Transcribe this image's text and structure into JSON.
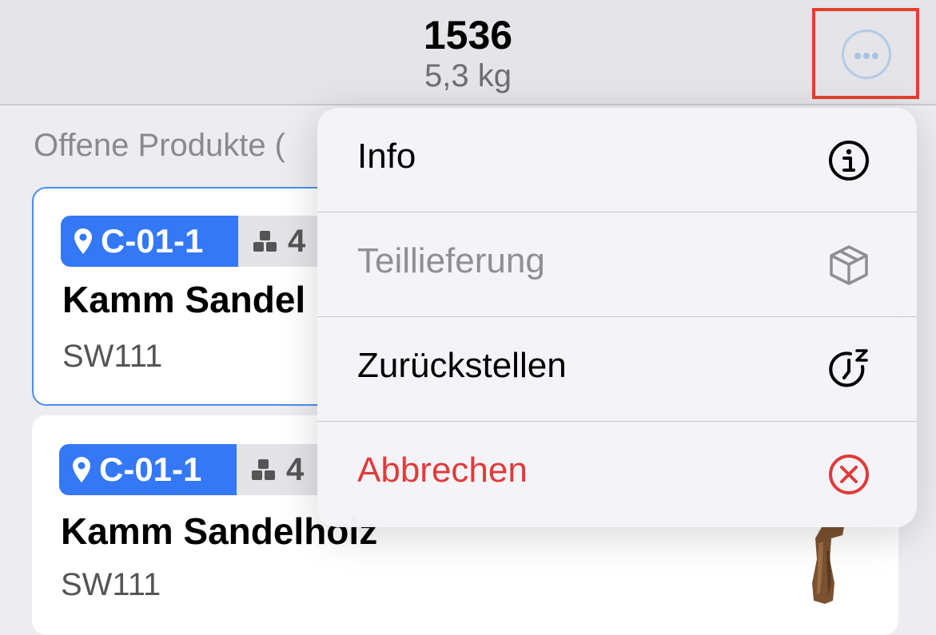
{
  "header": {
    "title": "1536",
    "subtitle": "5,3 kg"
  },
  "more_button": {
    "icon": "ellipsis-circle-icon",
    "highlight_color": "#e2412f"
  },
  "section": {
    "label": "Offene Produkte ("
  },
  "cards": [
    {
      "location": "C-01-1",
      "quantity": "4",
      "name": "Kamm Sandel",
      "sku": "SW111",
      "selected": true
    },
    {
      "location": "C-01-1",
      "quantity": "4",
      "name": "Kamm Sandelholz",
      "sku": "SW111",
      "selected": false
    }
  ],
  "menu": {
    "items": [
      {
        "label": "Info",
        "icon": "info-circle-icon",
        "state": "normal"
      },
      {
        "label": "Teillieferung",
        "icon": "package-box-icon",
        "state": "disabled"
      },
      {
        "label": "Zurückstellen",
        "icon": "snooze-clock-icon",
        "state": "normal"
      },
      {
        "label": "Abbrechen",
        "icon": "cancel-circle-icon",
        "state": "destructive"
      }
    ]
  },
  "colors": {
    "accent": "#3478f6",
    "destructive": "#e03b3b",
    "disabled": "#8e8e93",
    "selected_border": "#4a8df0"
  }
}
